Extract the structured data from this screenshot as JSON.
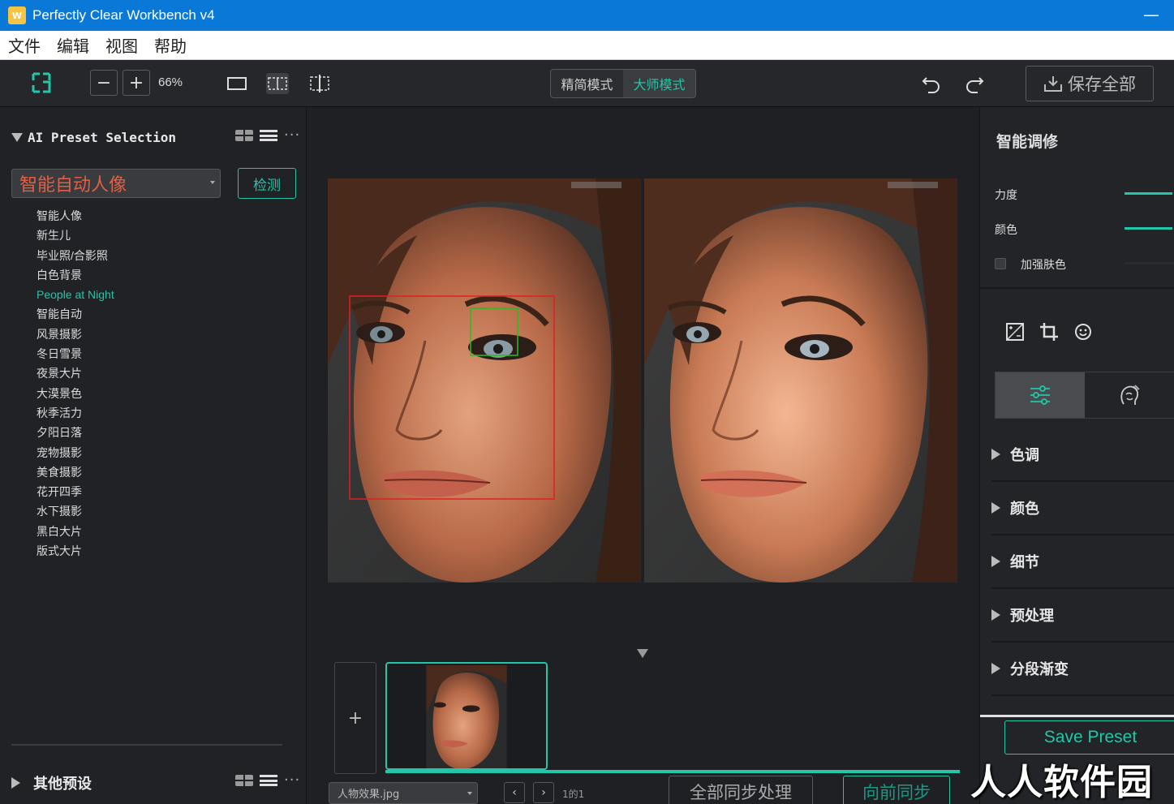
{
  "window": {
    "title": "Perfectly Clear Workbench v4",
    "app_icon": "W",
    "minimize": "—"
  },
  "menu": [
    "文件",
    "编辑",
    "视图",
    "帮助"
  ],
  "toolbar": {
    "zoom_out": "−",
    "zoom_in": "+",
    "zoom_level": "66%",
    "modes": [
      "精简模式",
      "大师模式"
    ],
    "active_mode": "大师模式",
    "save_all": "保存全部"
  },
  "left_panel": {
    "title": "AI Preset Selection",
    "more": "···",
    "selected_preset": "智能自动人像",
    "detect_button": "检测",
    "presets": [
      "智能人像",
      "新生儿",
      "毕业照/合影照",
      "白色背景",
      "People at Night",
      "智能自动",
      "风景摄影",
      "冬日雪景",
      "夜景大片",
      "大漠景色",
      "秋季活力",
      "夕阳日落",
      "宠物摄影",
      "美食摄影",
      "花开四季",
      "水下摄影",
      "黑白大片",
      "版式大片"
    ],
    "active_preset": "People at Night",
    "other_presets_title": "其他预设"
  },
  "center": {
    "add_label": "+",
    "file_name": "人物效果.jpg",
    "prev": "‹",
    "next": "›",
    "page_count": "1的1",
    "sync_all": "全部同步处理",
    "sync_forward": "向前同步"
  },
  "right_panel": {
    "title": "智能调修",
    "sliders": [
      {
        "label": "力度",
        "value": 0.95
      },
      {
        "label": "颜色",
        "value": 0.95
      }
    ],
    "checkbox_label": "加强肤色",
    "checkbox_checked": false,
    "sections": [
      "色调",
      "颜色",
      "细节",
      "预处理",
      "分段渐变"
    ],
    "save_preset": "Save Preset"
  },
  "thumbnail_progress": 1.0,
  "watermark": "人人软件园",
  "colors": {
    "accent": "#22c7a9",
    "titlebar": "#0a78d7",
    "preset_red": "#e06045"
  }
}
